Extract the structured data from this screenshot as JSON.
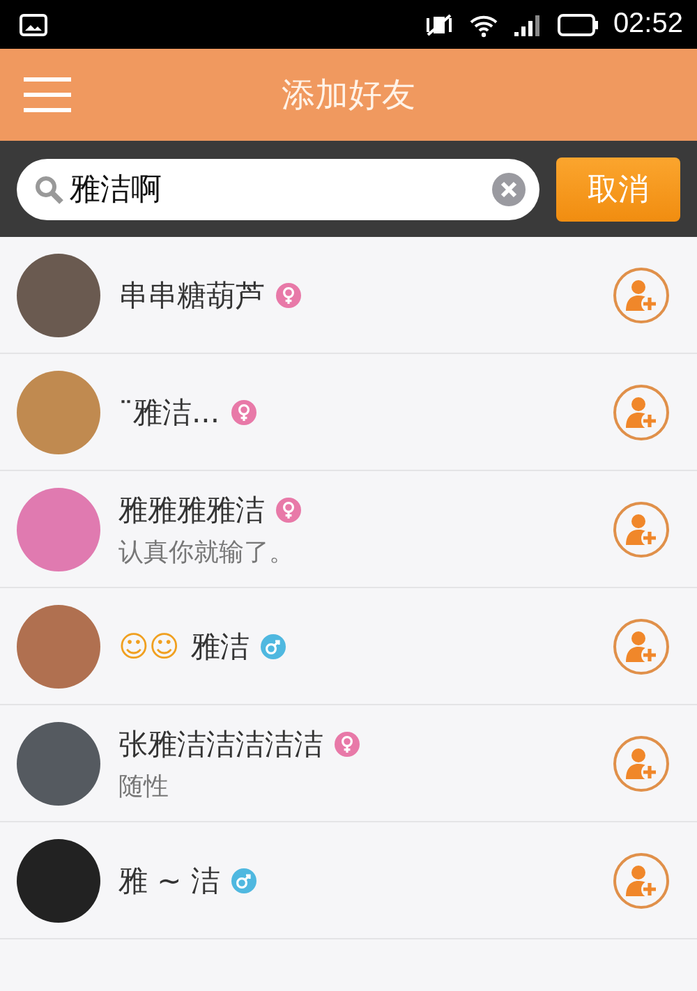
{
  "status_bar": {
    "time": "02:52"
  },
  "header": {
    "title": "添加好友"
  },
  "search": {
    "value": "雅洁啊",
    "cancel": "取消"
  },
  "results": [
    {
      "name": "串串糖葫芦",
      "kind": "female"
    },
    {
      "name": "¨雅洁...",
      "kind": "female"
    },
    {
      "name": "雅雅雅雅洁",
      "kind": "female",
      "signature": "认真你就输了。"
    },
    {
      "prefix": "☺☺",
      "name": "雅洁",
      "kind": "male"
    },
    {
      "name": "张雅洁洁洁洁洁",
      "kind": "female",
      "signature": "随性"
    },
    {
      "name": "雅 ~ 洁",
      "kind": "male"
    }
  ]
}
